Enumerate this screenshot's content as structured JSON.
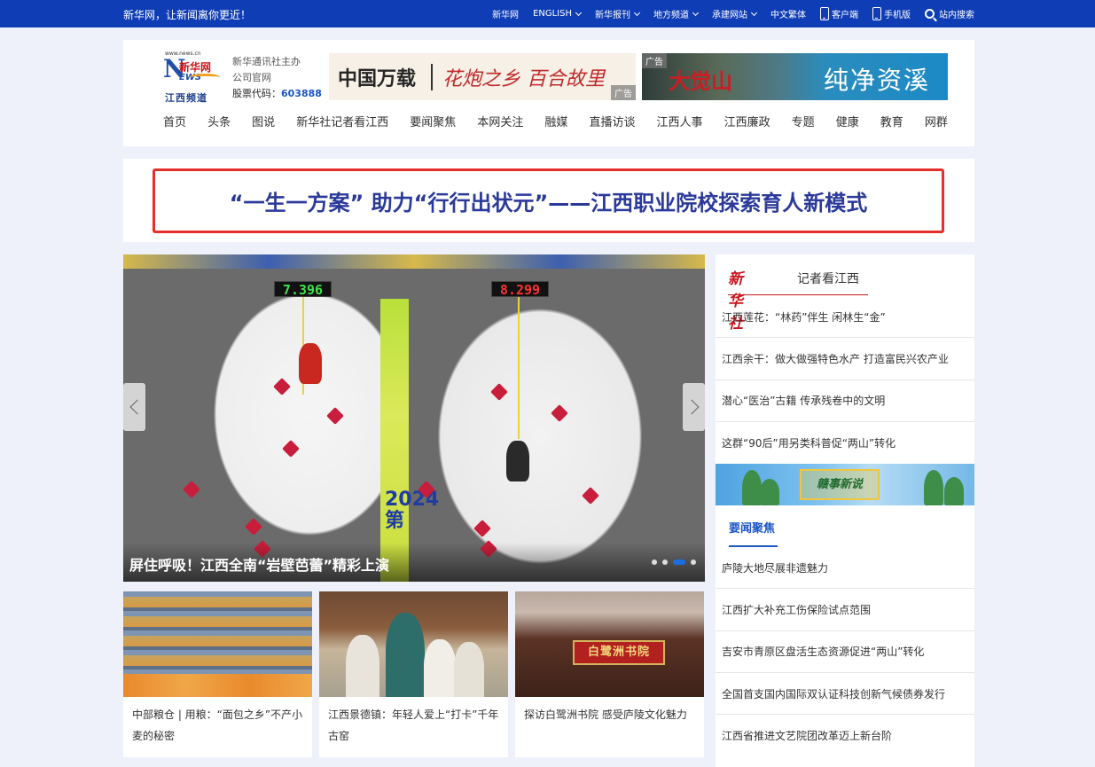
{
  "topbar": {
    "slogan": "新华网，让新闻离你更近！",
    "links": [
      {
        "label": "新华网",
        "dropdown": false
      },
      {
        "label": "ENGLISH",
        "dropdown": true
      },
      {
        "label": "新华报刊",
        "dropdown": true
      },
      {
        "label": "地方频道",
        "dropdown": true
      },
      {
        "label": "承建网站",
        "dropdown": true
      },
      {
        "label": "中文繁体",
        "dropdown": false
      }
    ],
    "client": "客户端",
    "mobile": "手机版",
    "search": "站内搜索"
  },
  "logo": {
    "url": "www.news.cn",
    "brand": "新华网",
    "news": "EWS",
    "channel": "江西频道"
  },
  "host": {
    "line1": "新华通讯社主办",
    "line2": "公司官网",
    "stock_label": "股票代码：",
    "stock_code": "603888"
  },
  "ads": {
    "ad1_title": "中国万载",
    "ad1_slogan": "花炮之乡 百合故里",
    "ad1_tag": "广告",
    "ad2_tag": "广告",
    "ad2_mountain": "大觉山",
    "ad2_slogan": "纯净资溪"
  },
  "nav": [
    "首页",
    "头条",
    "图说",
    "新华社记者看江西",
    "要闻聚焦",
    "本网关注",
    "融媒",
    "直播访谈",
    "江西人事",
    "江西廉政",
    "专题",
    "健康",
    "教育",
    "网群"
  ],
  "headline": "“一生一方案” 助力“行行出状元”——江西职业院校探索育人新模式",
  "slider": {
    "score_left": "7.396",
    "score_right": "8.299",
    "banner_text": "2024第",
    "caption": "屏住呼吸！江西全南“岩壁芭蕾”精彩上演",
    "dots": 4,
    "active_dot": 2
  },
  "thumbs": [
    {
      "caption": "中部粮仓 | 用粮：“面包之乡”不产小麦的秘密"
    },
    {
      "caption": "江西景德镇：年轻人爱上“打卡”千年古窑"
    },
    {
      "caption": "探访白鹭洲书院 感受庐陵文化魅力",
      "plaque": "白鹭洲书院"
    }
  ],
  "right": {
    "xhs_logo": "新华社",
    "xhs_sub": "记者看江西",
    "xhs_items": [
      "江西莲花：“林药”伴生 闲林生“金”",
      "江西余干：做大做强特色水产 打造富民兴农产业",
      "潜心“医治”古籍 传承残卷中的文明",
      "这群“90后”用另类科普促“两山”转化"
    ],
    "promo": "赣事新说",
    "yw_title": "要闻聚焦",
    "yw_items": [
      "庐陵大地尽展非遗魅力",
      "江西扩大补充工伤保险试点范围",
      "吉安市青原区盘活生态资源促进“两山”转化",
      "全国首支国内国际双认证科技创新气候债券发行",
      "江西省推进文艺院团改革迈上新台阶"
    ]
  },
  "colors": {
    "topbar": "#0f3db5",
    "accent_blue": "#1a56c4",
    "headline_border": "#e3302b",
    "headline_text": "#2b3a9a",
    "brand_red": "#c8161d",
    "page_bg": "#eef1f9"
  }
}
